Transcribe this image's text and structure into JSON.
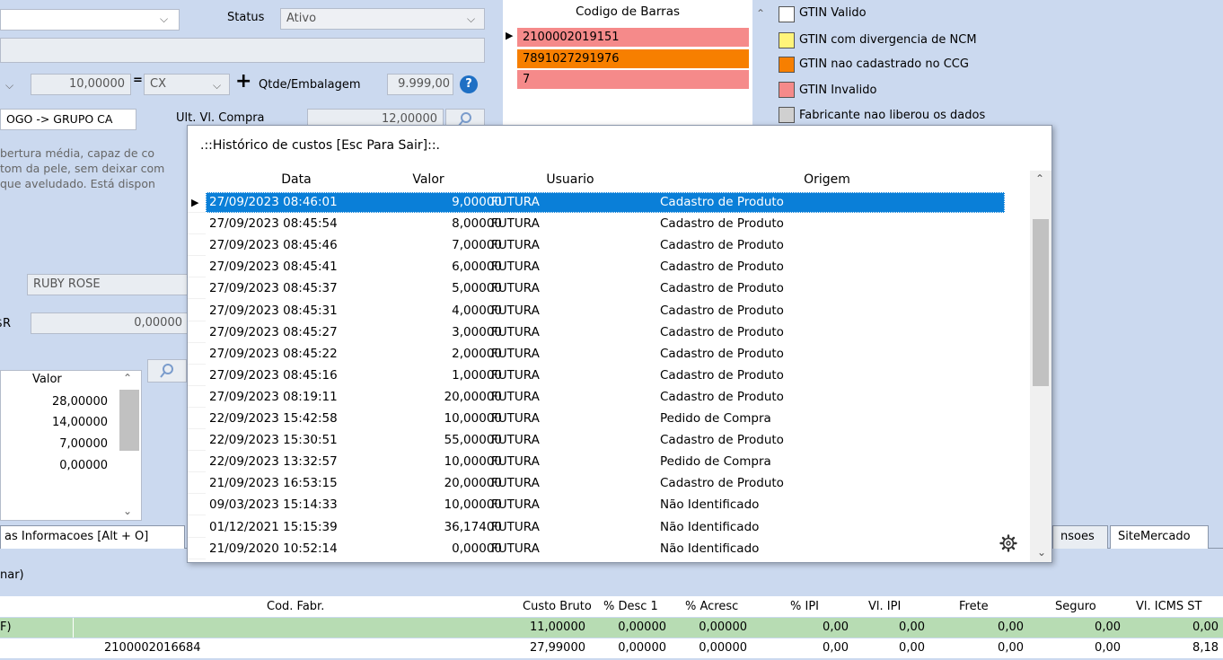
{
  "form": {
    "status_label": "Status",
    "status_value": "Ativo",
    "qty_value": "10,00000",
    "equals": "=",
    "unit_value": "CX",
    "plus": "+",
    "qtde_label": "Qtde/Embalagem",
    "qtde_value": "9.999,00",
    "category_text": "OGO -> GRUPO CA",
    "ult_label": "Ult. Vl. Compra",
    "ult_value": "12,00000",
    "desc_lines": [
      "bertura média, capaz de co",
      "tom da pele, sem deixar com",
      "que aveludado. Está dispon"
    ],
    "brand_value": "RUBY ROSE",
    "currency_label": "R$",
    "currency_value": "0,00000",
    "valor_header": "Valor",
    "valor_list": [
      "28,00000",
      "14,00000",
      "7,00000",
      "0,00000"
    ]
  },
  "barcodes": {
    "header": "Codigo de Barras",
    "items": [
      {
        "code": "2100002019151",
        "color": "#f58a8a"
      },
      {
        "code": "7891027291976",
        "color": "#f77f00"
      },
      {
        "code": "7",
        "color": "#f58a8a"
      }
    ]
  },
  "legend": [
    {
      "label": "GTIN Valido",
      "color": "#ffffff"
    },
    {
      "label": "GTIN com divergencia de NCM",
      "color": "#fff47a"
    },
    {
      "label": "GTIN nao cadastrado no CCG",
      "color": "#f77f00"
    },
    {
      "label": "GTIN Invalido",
      "color": "#f58a8a"
    },
    {
      "label": "Fabricante nao liberou os dados",
      "color": "#d0d0d0"
    }
  ],
  "modal": {
    "title": ".::Histórico de custos [Esc Para Sair]::.",
    "columns": [
      "Data",
      "Valor",
      "Usuario",
      "Origem"
    ],
    "rows": [
      {
        "data": "27/09/2023 08:46:01",
        "valor": "9,00000",
        "usuario": "FUTURA",
        "origem": "Cadastro de Produto"
      },
      {
        "data": "27/09/2023 08:45:54",
        "valor": "8,00000",
        "usuario": "FUTURA",
        "origem": "Cadastro de Produto"
      },
      {
        "data": "27/09/2023 08:45:46",
        "valor": "7,00000",
        "usuario": "FUTURA",
        "origem": "Cadastro de Produto"
      },
      {
        "data": "27/09/2023 08:45:41",
        "valor": "6,00000",
        "usuario": "FUTURA",
        "origem": "Cadastro de Produto"
      },
      {
        "data": "27/09/2023 08:45:37",
        "valor": "5,00000",
        "usuario": "FUTURA",
        "origem": "Cadastro de Produto"
      },
      {
        "data": "27/09/2023 08:45:31",
        "valor": "4,00000",
        "usuario": "FUTURA",
        "origem": "Cadastro de Produto"
      },
      {
        "data": "27/09/2023 08:45:27",
        "valor": "3,00000",
        "usuario": "FUTURA",
        "origem": "Cadastro de Produto"
      },
      {
        "data": "27/09/2023 08:45:22",
        "valor": "2,00000",
        "usuario": "FUTURA",
        "origem": "Cadastro de Produto"
      },
      {
        "data": "27/09/2023 08:45:16",
        "valor": "1,00000",
        "usuario": "FUTURA",
        "origem": "Cadastro de Produto"
      },
      {
        "data": "27/09/2023 08:19:11",
        "valor": "20,00000",
        "usuario": "FUTURA",
        "origem": "Cadastro de Produto"
      },
      {
        "data": "22/09/2023 15:42:58",
        "valor": "10,00000",
        "usuario": "FUTURA",
        "origem": "Pedido de Compra"
      },
      {
        "data": "22/09/2023 15:30:51",
        "valor": "55,00000",
        "usuario": "FUTURA",
        "origem": "Cadastro de Produto"
      },
      {
        "data": "22/09/2023 13:32:57",
        "valor": "10,00000",
        "usuario": "FUTURA",
        "origem": "Pedido de Compra"
      },
      {
        "data": "21/09/2023 16:53:15",
        "valor": "20,00000",
        "usuario": "FUTURA",
        "origem": "Cadastro de Produto"
      },
      {
        "data": "09/03/2023 15:14:33",
        "valor": "10,00000",
        "usuario": "FUTURA",
        "origem": "Não Identificado"
      },
      {
        "data": "01/12/2021 15:15:39",
        "valor": "36,17400",
        "usuario": "FUTURA",
        "origem": "Não Identificado"
      },
      {
        "data": "21/09/2020 10:52:14",
        "valor": "0,00000",
        "usuario": "FUTURA",
        "origem": "Não Identificado"
      }
    ]
  },
  "tabs": [
    "as Informacoes [Alt + O]",
    "nsoes",
    "SiteMercado"
  ],
  "section_label": "nar)",
  "grid": {
    "columns": [
      "Cod. Fabr.",
      "Custo Bruto",
      "% Desc 1",
      "% Acresc",
      "% IPI",
      "Vl. IPI",
      "Frete",
      "Seguro",
      "Vl. ICMS ST"
    ],
    "rows": [
      {
        "lead": "F)",
        "cod": "",
        "values": [
          "11,00000",
          "0,00000",
          "0,00000",
          "0,00",
          "0,00",
          "0,00",
          "0,00",
          "0,00"
        ]
      },
      {
        "lead": "",
        "cod": "2100002016684",
        "values": [
          "27,99000",
          "0,00000",
          "0,00000",
          "0,00",
          "0,00",
          "0,00",
          "0,00",
          "8,18"
        ]
      }
    ]
  }
}
